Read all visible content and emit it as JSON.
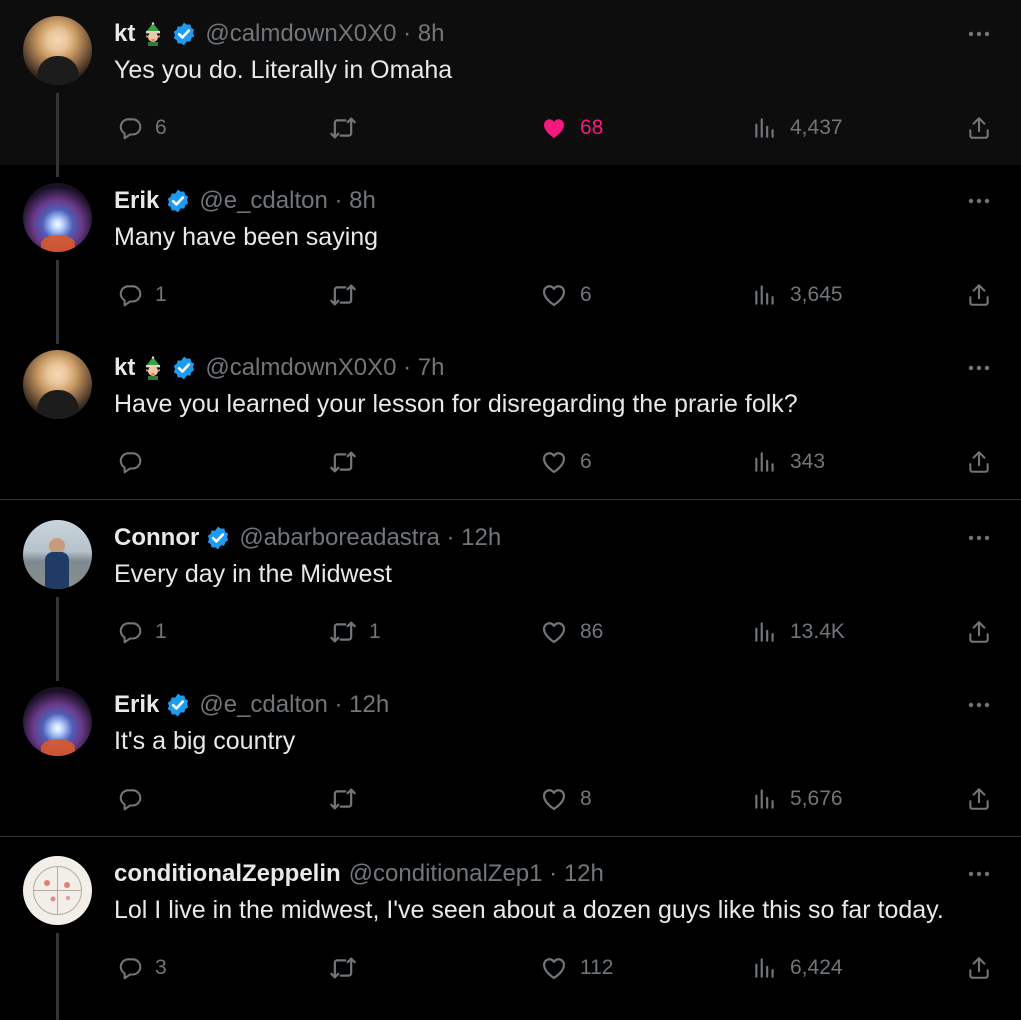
{
  "colors": {
    "background": "#000000",
    "text": "#e7e9ea",
    "muted": "#71767b",
    "like": "#f91880",
    "verified": "#1d9bf0"
  },
  "tweets": [
    {
      "name": "kt",
      "emoji": "elf-emoji",
      "handle": "@calmdownX0X0 · 8h",
      "text": "Yes you do. Literally in Omaha",
      "replies": "6",
      "retweets": "",
      "likes": "68",
      "liked": true,
      "views": "4,437"
    },
    {
      "name": "Erik",
      "handle": "@e_cdalton · 8h",
      "text": "Many have been saying",
      "replies": "1",
      "retweets": "",
      "likes": "6",
      "liked": false,
      "views": "3,645"
    },
    {
      "name": "kt",
      "emoji": "elf-emoji",
      "handle": "@calmdownX0X0 · 7h",
      "text": "Have you learned your lesson for disregarding the prarie folk?",
      "replies": "",
      "retweets": "",
      "likes": "6",
      "liked": false,
      "views": "343"
    },
    {
      "name": "Connor",
      "handle": "@abarboreadastra · 12h",
      "text": "Every day in the Midwest",
      "replies": "1",
      "retweets": "1",
      "likes": "86",
      "liked": false,
      "views": "13.4K"
    },
    {
      "name": "Erik",
      "handle": "@e_cdalton · 12h",
      "text": "It's a big country",
      "replies": "",
      "retweets": "",
      "likes": "8",
      "liked": false,
      "views": "5,676"
    },
    {
      "name": "conditionalZeppelin",
      "handle": "@conditionalZep1 · 12h",
      "text": "Lol I live in the midwest, I've seen about a dozen guys like this so far today.",
      "replies": "3",
      "retweets": "",
      "likes": "112",
      "liked": false,
      "views": "6,424"
    }
  ]
}
